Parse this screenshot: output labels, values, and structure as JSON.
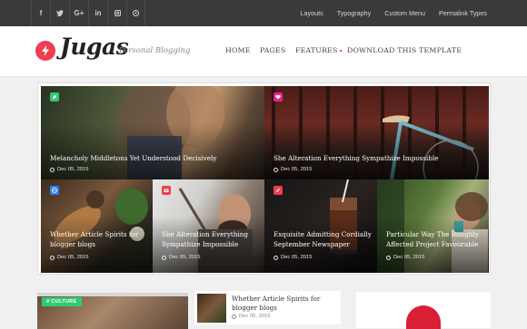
{
  "topbar": {
    "social_icons": [
      {
        "name": "facebook-icon",
        "glyph": "f"
      },
      {
        "name": "twitter-icon",
        "glyph": "•"
      },
      {
        "name": "google-plus-icon",
        "glyph": "G+"
      },
      {
        "name": "linkedin-icon",
        "glyph": "in"
      },
      {
        "name": "instagram-icon",
        "glyph": "▣"
      },
      {
        "name": "pinterest-icon",
        "glyph": "⊙"
      }
    ],
    "menu": [
      "Layouts",
      "Typography",
      "Custom Menu",
      "Permalink Types"
    ]
  },
  "header": {
    "logo_text": "Jugas",
    "tagline": "Personal Blogging",
    "nav": [
      "HOME",
      "PAGES",
      "FEATURES",
      "DOWNLOAD THIS TEMPLATE"
    ],
    "accent": "#ee3e4f"
  },
  "featured": [
    {
      "title": "Melancholy Middletons Yet Understood Decisively",
      "date": "Dec 05, 2015",
      "badge_color": "#2ecc71",
      "badge_icon": "leaf-icon"
    },
    {
      "title": "She Alteration Everything Sympathize Impossible",
      "date": "Dec 05, 2015",
      "badge_color": "#e91e8c",
      "badge_icon": "heart-icon"
    },
    {
      "title": "Whether Article Spirits for blogger blogs",
      "date": "Dec 05, 2015",
      "badge_color": "#2f80ed",
      "badge_icon": "globe-icon"
    },
    {
      "title": "She Alteration Everything Sympathize Impossible",
      "date": "Dec 05, 2015",
      "badge_color": "#ee3e4f",
      "badge_icon": "camera-icon"
    },
    {
      "title": "Exquisite Admitting Cordially September Newspaper",
      "date": "Dec 05, 2015",
      "badge_color": "#ee3e4f",
      "badge_icon": "pencil-icon"
    },
    {
      "title": "Particular Way The Roughly Affected Project Favourable",
      "date": "Dec 05, 2015",
      "badge_color": null,
      "badge_icon": null
    }
  ],
  "below": {
    "culture_label": "# CULTURE",
    "list_item": {
      "title": "Whether Article Spirits for blogger blogs",
      "date": "Dec 05, 2015"
    }
  }
}
